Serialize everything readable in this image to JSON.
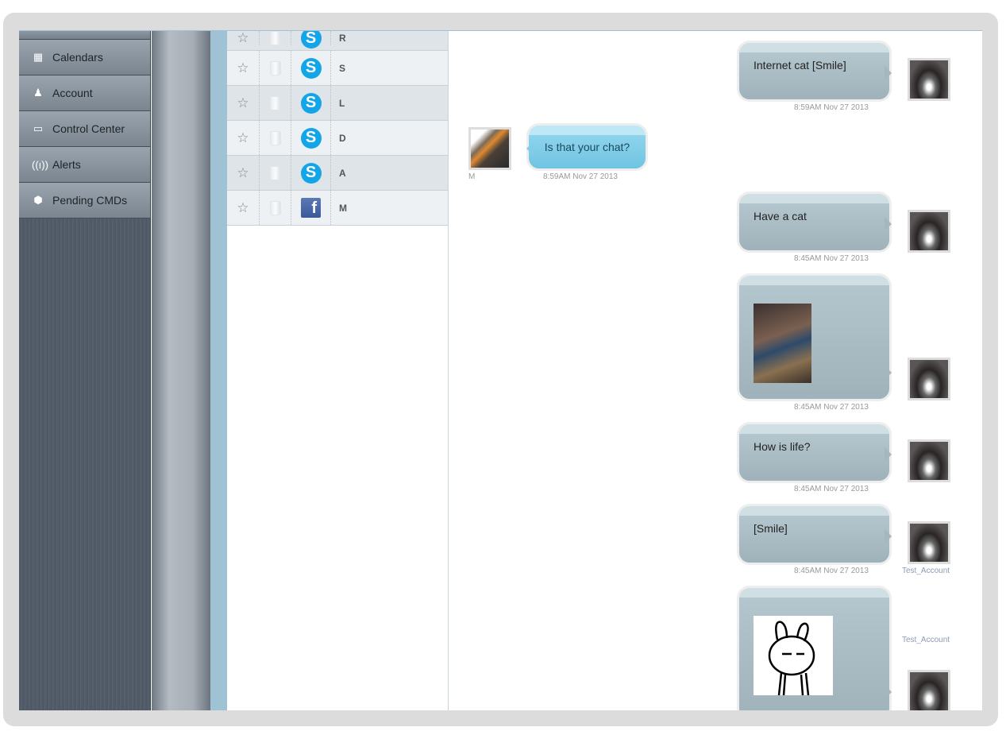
{
  "sidebar": {
    "items": [
      {
        "label": "Calendars",
        "icon": "calendar-icon"
      },
      {
        "label": "Account",
        "icon": "user-icon"
      },
      {
        "label": "Control Center",
        "icon": "tablet-icon"
      },
      {
        "label": "Alerts",
        "icon": "antenna-icon"
      },
      {
        "label": "Pending CMDs",
        "icon": "pending-icon"
      }
    ]
  },
  "contacts": [
    {
      "name": "R",
      "service": "skype"
    },
    {
      "name": "S",
      "service": "skype"
    },
    {
      "name": "L",
      "service": "skype"
    },
    {
      "name": "D",
      "service": "skype"
    },
    {
      "name": "A",
      "service": "skype"
    },
    {
      "name": "M",
      "service": "facebook"
    }
  ],
  "messages": [
    {
      "side": "right",
      "text": "Internet cat [Smile]",
      "time": "8:59AM Nov 27 2013"
    },
    {
      "side": "left",
      "text": "Is that your chat?",
      "time": "8:59AM Nov 27 2013",
      "sender": "M"
    },
    {
      "side": "right",
      "text": "Have a cat",
      "time": "8:45AM Nov 27 2013"
    },
    {
      "side": "right",
      "image": "cat-photo",
      "time": "8:45AM Nov 27 2013"
    },
    {
      "side": "right",
      "text": "How is life?",
      "time": "8:45AM Nov 27 2013"
    },
    {
      "side": "right",
      "text": "[Smile]",
      "time": "8:45AM Nov 27 2013",
      "sender": "Test_Account"
    },
    {
      "side": "right",
      "image": "rabbit-sticker",
      "sender": "Test_Account"
    }
  ],
  "colors": {
    "skype": "#12a5e8",
    "facebook": "#3b5998",
    "accent": "#9fc3d4"
  }
}
